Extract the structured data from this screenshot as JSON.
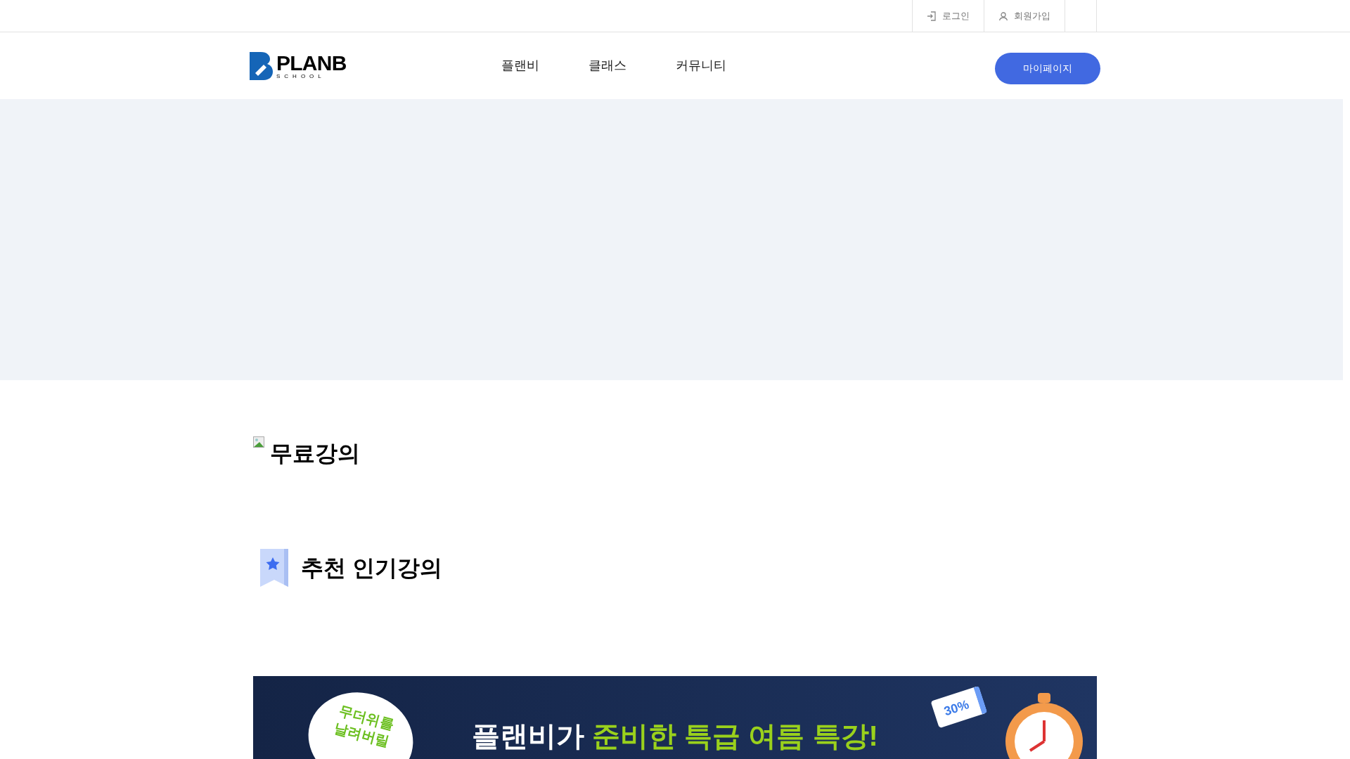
{
  "top_links": [
    {
      "kind": "login",
      "label": "로그인"
    },
    {
      "kind": "signup",
      "label": "회원가입"
    }
  ],
  "logo": {
    "name": "PLANB",
    "sub": "SCHOOL"
  },
  "nav": [
    "플랜비",
    "클래스",
    "커뮤니티"
  ],
  "mypage_button": "마이페이지",
  "sections": [
    {
      "kind": "broken-image",
      "title": "무료강의"
    },
    {
      "kind": "bookmark",
      "title": "추천 인기강의"
    }
  ],
  "banner": {
    "badge_lines": [
      "무더위를",
      "날려버릴"
    ],
    "headline_white": "플랜비가",
    "headline_green": "준비한 특급 여름 특강!",
    "coupon": "30%"
  }
}
